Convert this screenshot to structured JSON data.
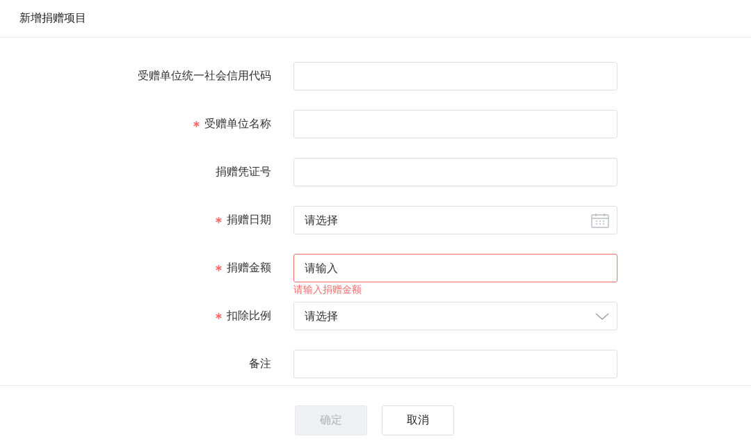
{
  "dialog": {
    "title": "新增捐赠项目"
  },
  "fields": [
    {
      "label": "受赠单位统一社会信用代码",
      "required": false,
      "kind": "text"
    },
    {
      "label": "受赠单位名称",
      "required": true,
      "kind": "text"
    },
    {
      "label": "捐赠凭证号",
      "required": false,
      "kind": "text"
    },
    {
      "label": "捐赠日期",
      "required": true,
      "kind": "date",
      "placeholder": "请选择"
    },
    {
      "label": "捐赠金额",
      "required": true,
      "kind": "text",
      "placeholder": "请输入",
      "invalid": true,
      "error": "请输入捐赠金额"
    },
    {
      "label": "扣除比例",
      "required": true,
      "kind": "select",
      "placeholder": "请选择"
    },
    {
      "label": "备注",
      "required": false,
      "kind": "text"
    }
  ],
  "buttons": [
    {
      "label": "确定",
      "disabled": true
    },
    {
      "label": "取消",
      "disabled": false
    }
  ]
}
